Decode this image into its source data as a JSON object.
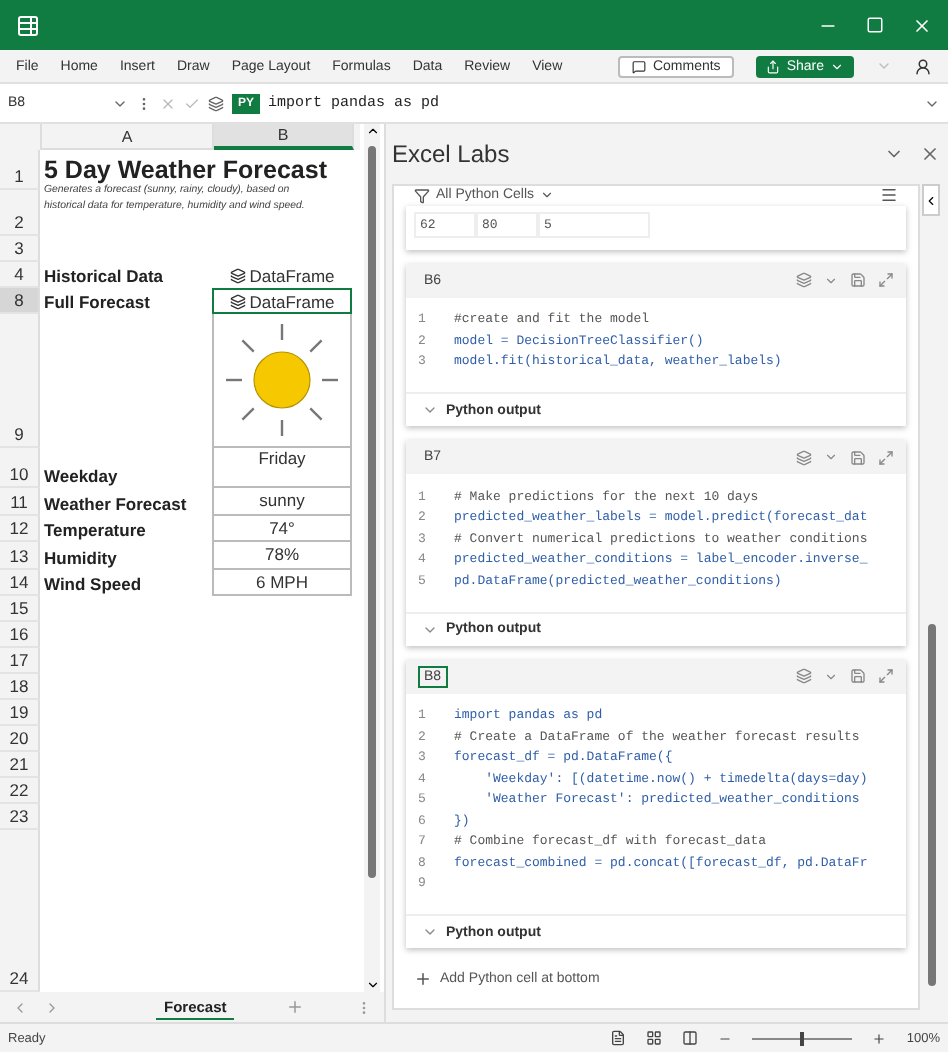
{
  "ribbon": {
    "tabs": [
      "File",
      "Home",
      "Insert",
      "Draw",
      "Page Layout",
      "Formulas",
      "Data",
      "Review",
      "View"
    ],
    "comments": "Comments",
    "share": "Share"
  },
  "formula_bar": {
    "name_box": "B8",
    "badge": "PY",
    "formula": "import pandas as pd"
  },
  "sheet": {
    "columns": [
      {
        "label": "A",
        "selected": false
      },
      {
        "label": "B",
        "selected": true
      }
    ],
    "rows": [
      {
        "number": "1",
        "selected": false,
        "kind": "title",
        "a": "5 Day Weather Forecast"
      },
      {
        "number": "2",
        "selected": false,
        "kind": "note",
        "a": "Generates a forecast (sunny, rainy, cloudy), based on historical data for temperature, humidity and wind speed."
      },
      {
        "number": "3",
        "selected": false,
        "kind": "blank"
      },
      {
        "number": "4",
        "selected": false,
        "kind": "python",
        "a": "Historical Data",
        "b": "DataFrame"
      },
      {
        "number": "8",
        "selected": true,
        "kind": "python",
        "a": "Full Forecast",
        "b": "DataFrame"
      },
      {
        "number": "9",
        "selected": false,
        "kind": "image"
      },
      {
        "number": "10",
        "selected": false,
        "kind": "header",
        "a": "Weekday",
        "b": "Friday"
      },
      {
        "number": "11",
        "selected": false,
        "kind": "table",
        "a": "Weather Forecast",
        "b": "sunny"
      },
      {
        "number": "12",
        "selected": false,
        "kind": "table",
        "a": "Temperature",
        "b": "74°"
      },
      {
        "number": "13",
        "selected": false,
        "kind": "table",
        "a": "Humidity",
        "b": "78%"
      },
      {
        "number": "14",
        "selected": false,
        "kind": "table",
        "a": "Wind Speed",
        "b": "6 MPH"
      },
      {
        "number": "15",
        "selected": false,
        "kind": "blank"
      },
      {
        "number": "16",
        "selected": false,
        "kind": "blank"
      },
      {
        "number": "17",
        "selected": false,
        "kind": "blank"
      },
      {
        "number": "18",
        "selected": false,
        "kind": "blank"
      },
      {
        "number": "19",
        "selected": false,
        "kind": "blank"
      },
      {
        "number": "20",
        "selected": false,
        "kind": "blank"
      },
      {
        "number": "21",
        "selected": false,
        "kind": "blank"
      },
      {
        "number": "22",
        "selected": false,
        "kind": "blank"
      },
      {
        "number": "23",
        "selected": false,
        "kind": "blank"
      },
      {
        "number": "24",
        "selected": false,
        "kind": "filler"
      }
    ],
    "tabs": [
      {
        "label": "Forecast",
        "selected": true
      }
    ]
  },
  "panel": {
    "title": "Excel Labs",
    "filter": "All Python Cells",
    "partial_table": [
      "62",
      "80",
      "5"
    ],
    "cells": [
      {
        "ref": "B6",
        "selected": false,
        "output": "Python output",
        "lines": [
          {
            "number": "1",
            "kind": "comment",
            "text": "#create and fit the model"
          },
          {
            "number": "2",
            "kind": "code",
            "text": "model = DecisionTreeClassifier()"
          },
          {
            "number": "3",
            "kind": "code",
            "text": "model.fit(historical_data, weather_labels)"
          }
        ]
      },
      {
        "ref": "B7",
        "selected": false,
        "output": "Python output",
        "lines": [
          {
            "number": "1",
            "kind": "comment",
            "text": "# Make predictions for the next 10 days"
          },
          {
            "number": "2",
            "kind": "code",
            "text": "predicted_weather_labels = model.predict(forecast_dat"
          },
          {
            "number": "3",
            "kind": "comment",
            "text": "# Convert numerical predictions to weather conditions"
          },
          {
            "number": "4",
            "kind": "code",
            "text": "predicted_weather_conditions = label_encoder.inverse_"
          },
          {
            "number": "5",
            "kind": "code",
            "text": "pd.DataFrame(predicted_weather_conditions)"
          }
        ]
      },
      {
        "ref": "B8",
        "selected": true,
        "output": "Python output",
        "lines": [
          {
            "number": "1",
            "kind": "code",
            "text": "import pandas as pd"
          },
          {
            "number": "2",
            "kind": "comment",
            "text": "# Create a DataFrame of the weather forecast results"
          },
          {
            "number": "3",
            "kind": "code",
            "text": "forecast_df = pd.DataFrame({"
          },
          {
            "number": "4",
            "kind": "code",
            "text": "    'Weekday': [(datetime.now() + timedelta(days=day)"
          },
          {
            "number": "5",
            "kind": "code",
            "text": "    'Weather Forecast': predicted_weather_conditions"
          },
          {
            "number": "6",
            "kind": "code",
            "text": "})"
          },
          {
            "number": "7",
            "kind": "comment",
            "text": "# Combine forecast_df with forecast_data"
          },
          {
            "number": "8",
            "kind": "code",
            "text": "forecast_combined = pd.concat([forecast_df, pd.DataFr"
          },
          {
            "number": "9"
          }
        ]
      }
    ],
    "add": "Add Python cell at bottom"
  },
  "status_bar": {
    "status": "Ready",
    "zoom": "100%",
    "zoom_level": {
      "level": 0.5
    }
  }
}
